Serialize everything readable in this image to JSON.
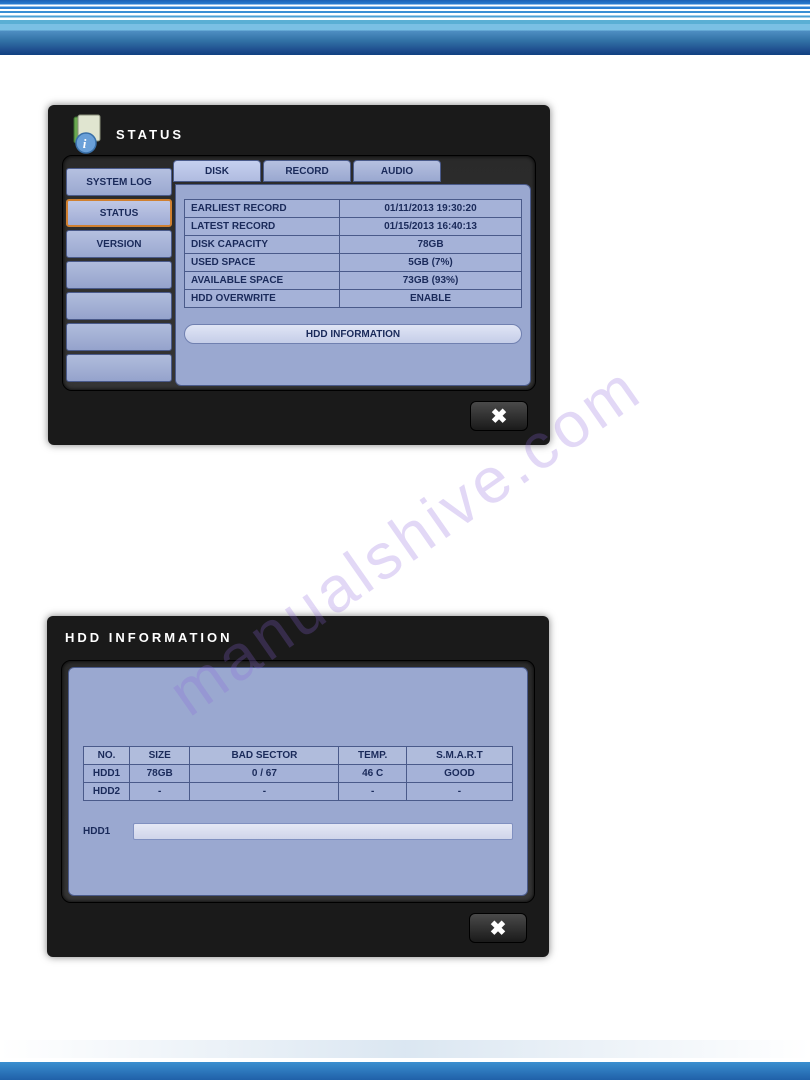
{
  "watermark": "manualshive.com",
  "status_panel": {
    "title": "STATUS",
    "sidebar": {
      "items": [
        {
          "label": "SYSTEM LOG",
          "active": false
        },
        {
          "label": "STATUS",
          "active": true
        },
        {
          "label": "VERSION",
          "active": false
        }
      ]
    },
    "tabs": [
      {
        "label": "DISK",
        "active": true
      },
      {
        "label": "RECORD",
        "active": false
      },
      {
        "label": "AUDIO",
        "active": false
      }
    ],
    "rows": [
      {
        "label": "EARLIEST RECORD",
        "value": "01/11/2013 19:30:20"
      },
      {
        "label": "LATEST RECORD",
        "value": "01/15/2013 16:40:13"
      },
      {
        "label": "DISK CAPACITY",
        "value": "78GB"
      },
      {
        "label": "USED SPACE",
        "value": "5GB (7%)"
      },
      {
        "label": "AVAILABLE SPACE",
        "value": "73GB (93%)"
      },
      {
        "label": "HDD OVERWRITE",
        "value": "ENABLE"
      }
    ],
    "hdd_info_button": "HDD INFORMATION"
  },
  "hdd_panel": {
    "title": "HDD INFORMATION",
    "columns": [
      "NO.",
      "SIZE",
      "BAD SECTOR",
      "TEMP.",
      "S.M.A.R.T"
    ],
    "rows": [
      {
        "no": "HDD1",
        "size": "78GB",
        "bad_sector": "0 / 67",
        "temp": "46 C",
        "smart": "GOOD"
      },
      {
        "no": "HDD2",
        "size": "-",
        "bad_sector": "-",
        "temp": "-",
        "smart": "-"
      }
    ],
    "progress_label": "HDD1"
  }
}
